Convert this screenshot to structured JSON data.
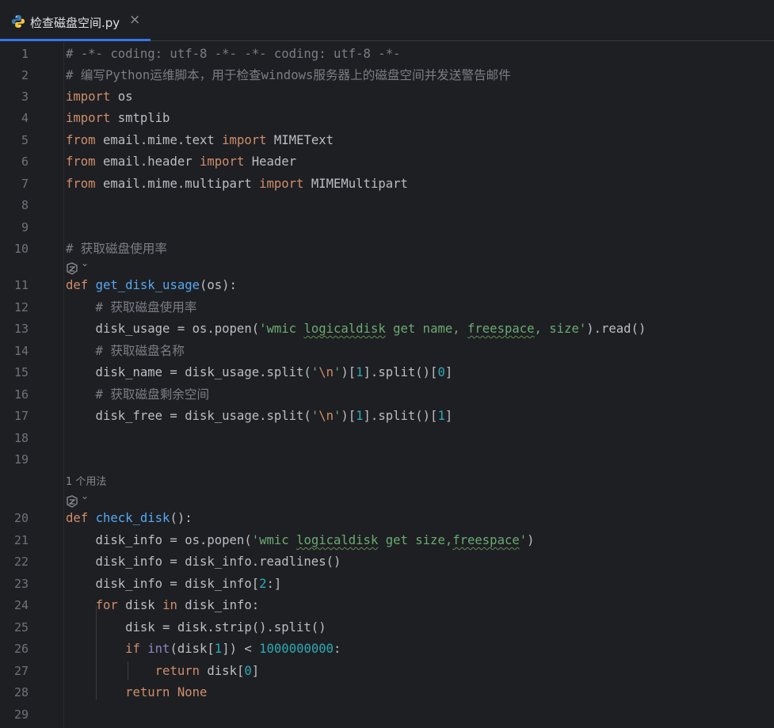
{
  "tab": {
    "title": "检查磁盘空间.py",
    "close": "×",
    "icon": "python-icon"
  },
  "hints": {
    "usage_count": "1 个用法",
    "chevron": "⌄"
  },
  "colors": {
    "accent": "#3574f0",
    "keyword": "#cf8e6d",
    "function": "#56a8f5",
    "string": "#6aab73",
    "number": "#2aacb8",
    "comment": "#7a7e85"
  },
  "lines": [
    {
      "n": "1",
      "text": "# -*- coding: utf-8 -*- -*- coding: utf-8 -*-"
    },
    {
      "n": "2",
      "text": "# 编写Python运维脚本，用于检查windows服务器上的磁盘空间并发送警告邮件"
    },
    {
      "n": "3",
      "text": "import os"
    },
    {
      "n": "4",
      "text": "import smtplib"
    },
    {
      "n": "5",
      "text": "from email.mime.text import MIMEText"
    },
    {
      "n": "6",
      "text": "from email.header import Header"
    },
    {
      "n": "7",
      "text": "from email.mime.multipart import MIMEMultipart"
    },
    {
      "n": "8",
      "text": ""
    },
    {
      "n": "9",
      "text": ""
    },
    {
      "n": "10",
      "text": "# 获取磁盘使用率"
    },
    {
      "n": "11",
      "text": "def get_disk_usage(os):"
    },
    {
      "n": "12",
      "text": "    # 获取磁盘使用率"
    },
    {
      "n": "13",
      "text": "    disk_usage = os.popen('wmic logicaldisk get name, freespace, size').read()"
    },
    {
      "n": "14",
      "text": "    # 获取磁盘名称"
    },
    {
      "n": "15",
      "text": "    disk_name = disk_usage.split('\\n')[1].split()[0]"
    },
    {
      "n": "16",
      "text": "    # 获取磁盘剩余空间"
    },
    {
      "n": "17",
      "text": "    disk_free = disk_usage.split('\\n')[1].split()[1]"
    },
    {
      "n": "18",
      "text": ""
    },
    {
      "n": "19",
      "text": ""
    },
    {
      "n": "20",
      "text": "def check_disk():"
    },
    {
      "n": "21",
      "text": "    disk_info = os.popen('wmic logicaldisk get size,freespace')"
    },
    {
      "n": "22",
      "text": "    disk_info = disk_info.readlines()"
    },
    {
      "n": "23",
      "text": "    disk_info = disk_info[2:]"
    },
    {
      "n": "24",
      "text": "    for disk in disk_info:"
    },
    {
      "n": "25",
      "text": "        disk = disk.strip().split()"
    },
    {
      "n": "26",
      "text": "        if int(disk[1]) < 1000000000:"
    },
    {
      "n": "27",
      "text": "            return disk[0]"
    },
    {
      "n": "28",
      "text": "        return None"
    },
    {
      "n": "29",
      "text": ""
    }
  ]
}
